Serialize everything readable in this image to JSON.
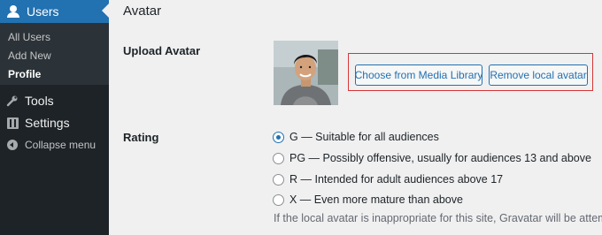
{
  "sidebar": {
    "users_label": "Users",
    "submenu": {
      "all_users": "All Users",
      "add_new": "Add New",
      "profile": "Profile"
    },
    "tools_label": "Tools",
    "settings_label": "Settings",
    "collapse_label": "Collapse menu"
  },
  "main": {
    "section_title": "Avatar",
    "upload": {
      "label": "Upload Avatar",
      "media_button": "Choose from Media Library",
      "remove_button": "Remove local avatar"
    },
    "rating": {
      "label": "Rating",
      "selected": "G",
      "options": [
        "G — Suitable for all audiences",
        "PG — Possibly offensive, usually for audiences 13 and above",
        "R — Intended for adult audiences above 17",
        "X — Even more mature than above"
      ],
      "description": "If the local avatar is inappropriate for this site, Gravatar will be attempted."
    }
  },
  "colors": {
    "sidebar_bg": "#1d2327",
    "submenu_bg": "#2c3338",
    "accent": "#2271b1",
    "highlight_border": "#d63638",
    "page_bg": "#f0f0f1"
  },
  "icons": {
    "users": "users-icon",
    "tools": "wrench-icon",
    "settings": "settings-icon",
    "collapse": "collapse-icon"
  }
}
